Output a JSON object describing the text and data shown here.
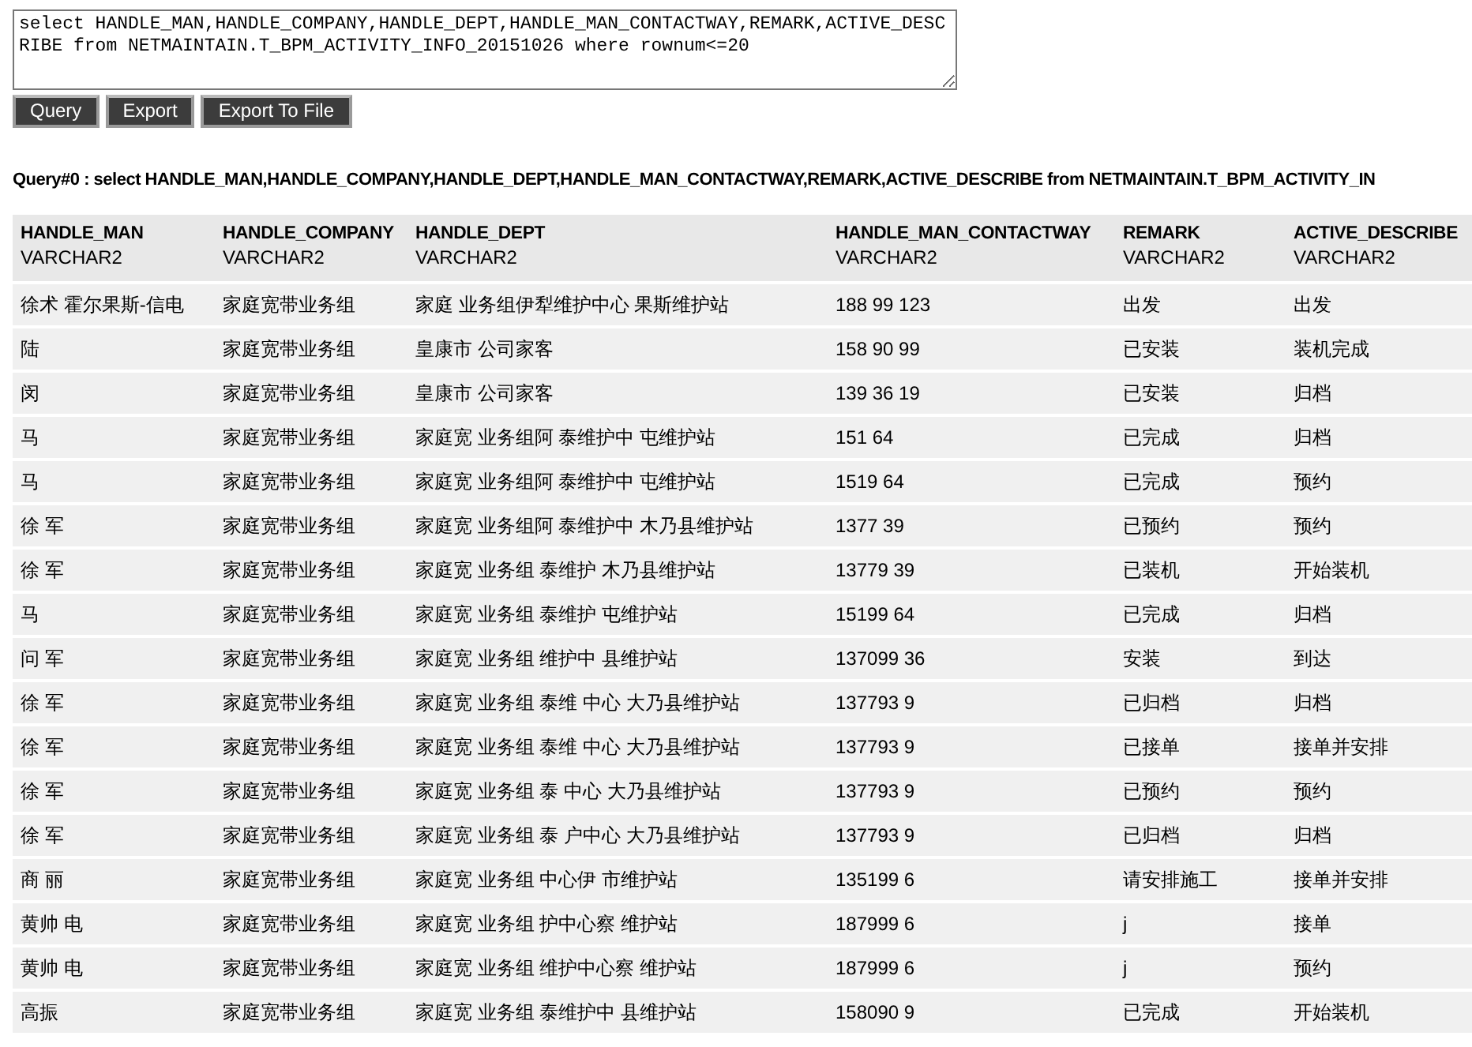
{
  "query_editor": {
    "value": "select HANDLE_MAN,HANDLE_COMPANY,HANDLE_DEPT,HANDLE_MAN_CONTACTWAY,REMARK,ACTIVE_DESCRIBE from NETMAINTAIN.T_BPM_ACTIVITY_INFO_20151026 where rownum<=20"
  },
  "buttons": [
    "Query",
    "Export",
    "Export To File"
  ],
  "result_title": "Query#0 : select HANDLE_MAN,HANDLE_COMPANY,HANDLE_DEPT,HANDLE_MAN_CONTACTWAY,REMARK,ACTIVE_DESCRIBE from NETMAINTAIN.T_BPM_ACTIVITY_IN",
  "table": {
    "columns": [
      {
        "name": "HANDLE_MAN",
        "type": "VARCHAR2"
      },
      {
        "name": "HANDLE_COMPANY",
        "type": "VARCHAR2"
      },
      {
        "name": "HANDLE_DEPT",
        "type": "VARCHAR2"
      },
      {
        "name": "HANDLE_MAN_CONTACTWAY",
        "type": "VARCHAR2"
      },
      {
        "name": "REMARK",
        "type": "VARCHAR2"
      },
      {
        "name": "ACTIVE_DESCRIBE",
        "type": "VARCHAR2"
      }
    ],
    "rows": [
      [
        "徐术 霍尔果斯-信电",
        "家庭宽带业务组",
        "家庭 业务组伊犁维护中心 果斯维护站",
        "188 99 123",
        "出发",
        "出发"
      ],
      [
        "陆",
        "家庭宽带业务组",
        "皇康市 公司家客",
        "158 90 99",
        "已安装",
        "装机完成"
      ],
      [
        "闵",
        "家庭宽带业务组",
        "皇康市 公司家客",
        "139 36 19",
        "已安装",
        "归档"
      ],
      [
        "马",
        "家庭宽带业务组",
        "家庭宽 业务组阿 泰维护中 屯维护站",
        "151 64",
        "已完成",
        "归档"
      ],
      [
        "马",
        "家庭宽带业务组",
        "家庭宽 业务组阿 泰维护中 屯维护站",
        "1519 64",
        "已完成",
        "预约"
      ],
      [
        "徐 军",
        "家庭宽带业务组",
        "家庭宽 业务组阿 泰维护中 木乃县维护站",
        "1377 39",
        "已预约",
        "预约"
      ],
      [
        "徐 军",
        "家庭宽带业务组",
        "家庭宽 业务组 泰维护 木乃县维护站",
        "13779 39",
        "已装机",
        "开始装机"
      ],
      [
        "马",
        "家庭宽带业务组",
        "家庭宽 业务组 泰维护 屯维护站",
        "15199 64",
        "已完成",
        "归档"
      ],
      [
        "问 军",
        "家庭宽带业务组",
        "家庭宽 业务组 维护中 县维护站",
        "137099 36",
        "安装",
        "到达"
      ],
      [
        "徐 军",
        "家庭宽带业务组",
        "家庭宽 业务组 泰维 中心 大乃县维护站",
        "137793 9",
        "已归档",
        "归档"
      ],
      [
        "徐 军",
        "家庭宽带业务组",
        "家庭宽 业务组 泰维 中心 大乃县维护站",
        "137793 9",
        "已接单",
        "接单并安排"
      ],
      [
        "徐 军",
        "家庭宽带业务组",
        "家庭宽 业务组 泰 中心 大乃县维护站",
        "137793 9",
        "已预约",
        "预约"
      ],
      [
        "徐 军",
        "家庭宽带业务组",
        "家庭宽 业务组 泰 户中心 大乃县维护站",
        "137793 9",
        "已归档",
        "归档"
      ],
      [
        "商 丽",
        "家庭宽带业务组",
        "家庭宽 业务组 中心伊 市维护站",
        "135199 6",
        "请安排施工",
        "接单并安排"
      ],
      [
        "黄帅 电",
        "家庭宽带业务组",
        "家庭宽 业务组 护中心察 维护站",
        "187999 6",
        "j",
        "接单"
      ],
      [
        "黄帅 电",
        "家庭宽带业务组",
        "家庭宽 业务组 维护中心察 维护站",
        "187999 6",
        "j",
        "预约"
      ],
      [
        "高振",
        "家庭宽带业务组",
        "家庭宽 业务组 泰维护中 县维护站",
        "158090 9",
        "已完成",
        "开始装机"
      ]
    ]
  }
}
